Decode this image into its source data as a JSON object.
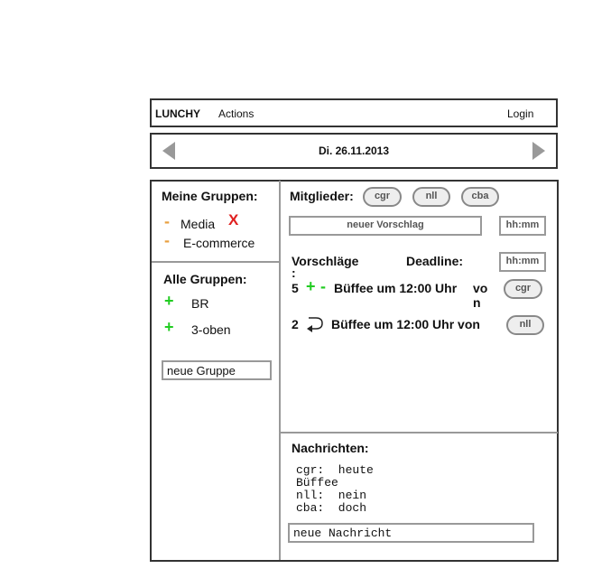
{
  "navbar": {
    "brand": "LUNCHY",
    "actions": "Actions",
    "login": "Login"
  },
  "datebar": {
    "date": "Di. 26.11.2013"
  },
  "left": {
    "my_groups_title": "Meine Gruppen:",
    "my_groups": [
      "Media",
      "E-commerce"
    ],
    "remove_mark": "X",
    "minus": "-",
    "all_groups_title": "Alle Gruppen:",
    "all_groups": [
      "BR",
      "3-oben"
    ],
    "plus": "+",
    "new_group_value": "neue Gruppe"
  },
  "members": {
    "title": "Mitglieder:",
    "list": [
      "cgr",
      "nll",
      "cba"
    ]
  },
  "proposal": {
    "input_value": "neuer Vorschlag",
    "time_placeholder": "hh:mm"
  },
  "suggestions": {
    "title": "Vorschläge",
    "colon": ":",
    "deadline_label": "Deadline:",
    "deadline_value": "hh:mm",
    "rows": [
      {
        "count": "5",
        "plus": "+",
        "minus": "-",
        "text": "Büffee um 12:00 Uhr",
        "von1": "vo",
        "von2": "n",
        "user": "cgr"
      },
      {
        "count": "2",
        "text": "Büffee um 12:00 Uhr von",
        "user": "nll"
      }
    ]
  },
  "messages": {
    "title": "Nachrichten:",
    "lines": [
      "cgr:  heute",
      "Büffee",
      "nll:  nein",
      "cba:  doch"
    ],
    "input_value": "neue Nachricht"
  }
}
